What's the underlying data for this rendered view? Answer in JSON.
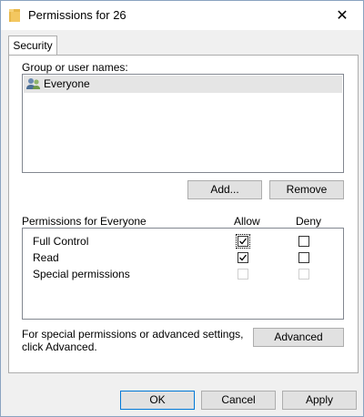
{
  "window": {
    "title": "Permissions for 26",
    "close_glyph": "✕"
  },
  "tabs": [
    {
      "label": "Security",
      "active": true
    }
  ],
  "group_section": {
    "label": "Group or user names:",
    "items": [
      {
        "name": "Everyone",
        "icon": "users-icon",
        "selected": true
      }
    ]
  },
  "buttons": {
    "add": "Add...",
    "remove": "Remove",
    "advanced": "Advanced",
    "ok": "OK",
    "cancel": "Cancel",
    "apply": "Apply"
  },
  "permissions": {
    "header": "Permissions for Everyone",
    "allow_header": "Allow",
    "deny_header": "Deny",
    "rows": [
      {
        "label": "Full Control",
        "allow": true,
        "deny": false,
        "enabled": true
      },
      {
        "label": "Read",
        "allow": true,
        "deny": false,
        "enabled": true
      },
      {
        "label": "Special permissions",
        "allow": false,
        "deny": false,
        "enabled": false
      }
    ]
  },
  "advanced_note": {
    "line1": "For special permissions or advanced settings,",
    "line2": "click Advanced."
  },
  "colors": {
    "window_bg": "#f0f0f0",
    "panel_bg": "#ffffff",
    "selection_bg": "#e5e5e5",
    "folder": "#e8b84a"
  }
}
